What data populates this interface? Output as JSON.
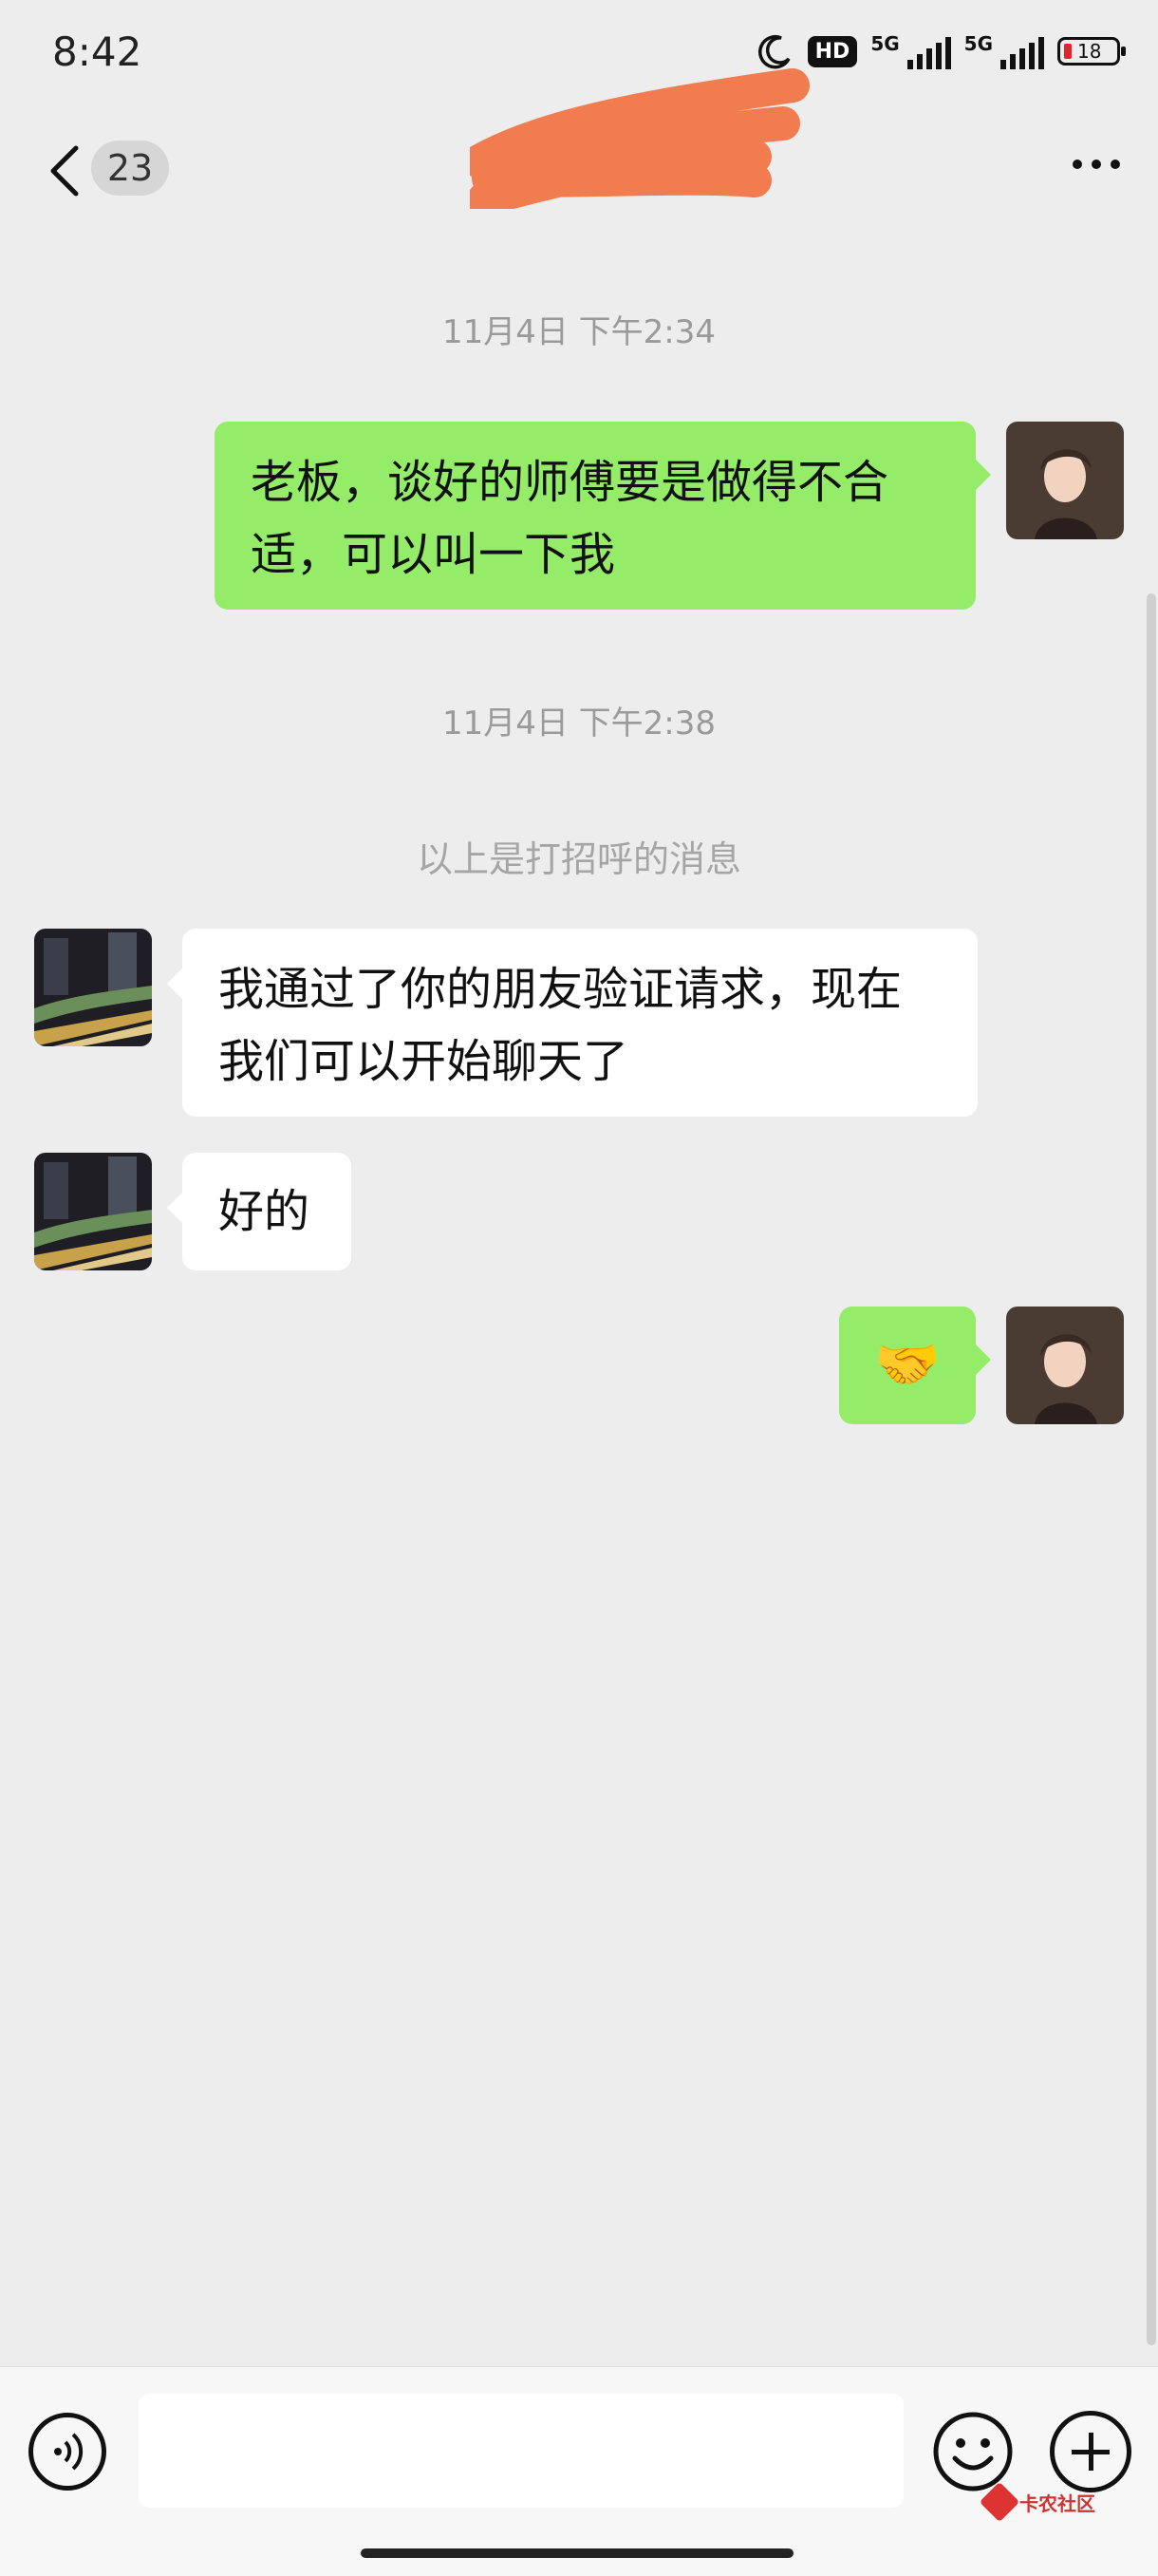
{
  "status_bar": {
    "time": "8:42",
    "hd_label": "HD",
    "net1": "5G",
    "net2": "5G",
    "battery": "18"
  },
  "nav": {
    "unread_count": "23",
    "title": ""
  },
  "colors": {
    "my_bubble": "#95ec69",
    "their_bubble": "#ffffff",
    "background": "#ededed",
    "scribble": "#f07c50"
  },
  "messages": {
    "t1": "11月4日 下午2:34",
    "m1": "老板，谈好的师傅要是做得不合适，可以叫一下我",
    "t2": "11月4日 下午2:38",
    "system": "以上是打招呼的消息",
    "m2": "我通过了你的朋友验证请求，现在我们可以开始聊天了",
    "m3": "好的",
    "m4": "🤝"
  },
  "input": {
    "value": "",
    "placeholder": ""
  },
  "watermark": {
    "text": "卡农社区"
  },
  "icons": [
    "back-chevron-icon",
    "more-dots-icon",
    "voice-icon",
    "emoji-icon",
    "plus-icon",
    "moon-icon",
    "signal-icon",
    "battery-icon"
  ]
}
